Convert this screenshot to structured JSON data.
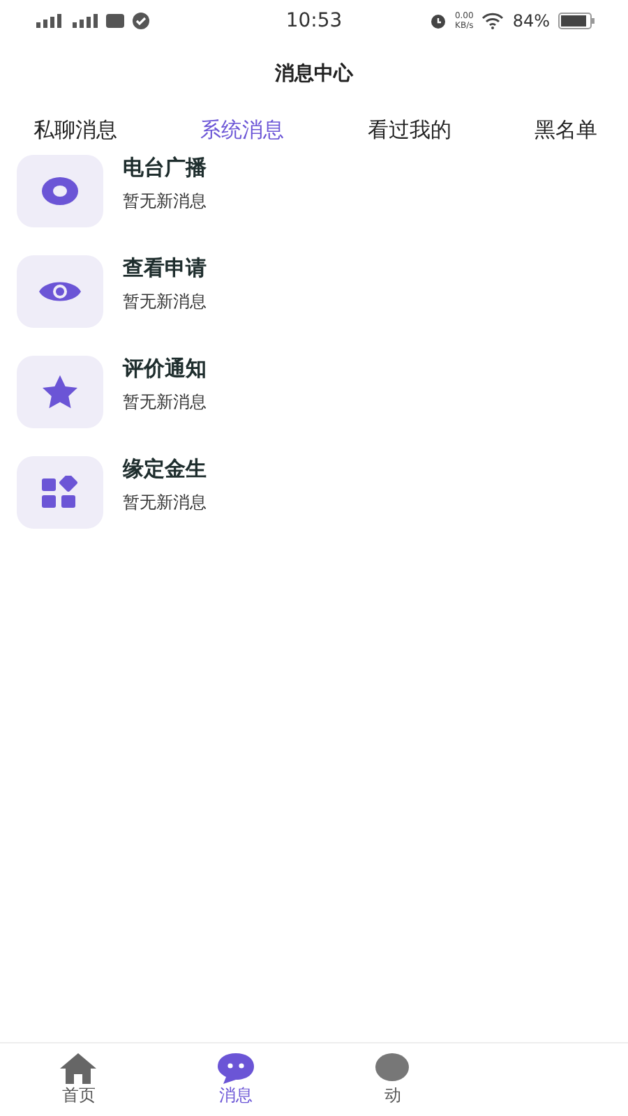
{
  "status_bar": {
    "time": "10:53",
    "speed": "0.00",
    "speed_unit": "KB/s",
    "battery": "84%"
  },
  "header": {
    "title": "消息中心"
  },
  "tabs": [
    {
      "label": "私聊消息",
      "selected": false
    },
    {
      "label": "系统消息",
      "selected": true
    },
    {
      "label": "看过我的",
      "selected": false
    },
    {
      "label": "黑名单",
      "selected": false
    }
  ],
  "messages": [
    {
      "kind": "disc",
      "title": "电台广播",
      "subtitle": "暂无新消息"
    },
    {
      "kind": "eye",
      "title": "查看申请",
      "subtitle": "暂无新消息"
    },
    {
      "kind": "star",
      "title": "评价通知",
      "subtitle": "暂无新消息"
    },
    {
      "kind": "grid",
      "title": "缘定金生",
      "subtitle": "暂无新消息"
    }
  ],
  "bottom_nav": [
    {
      "kind": "home",
      "label": "首页",
      "selected": false
    },
    {
      "kind": "chat",
      "label": "消息",
      "selected": true
    },
    {
      "kind": "moments",
      "label": "动",
      "selected": false
    }
  ]
}
